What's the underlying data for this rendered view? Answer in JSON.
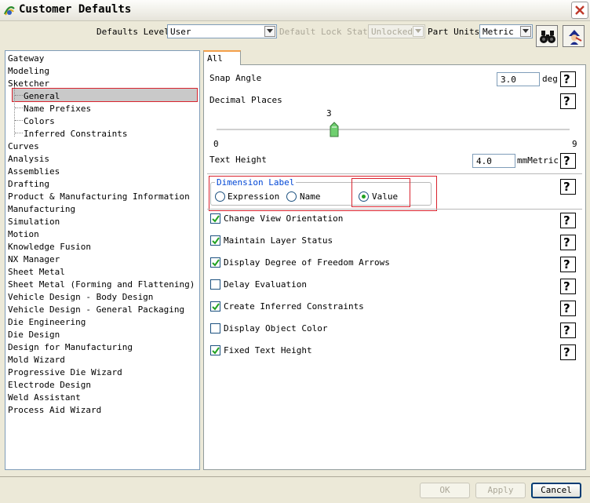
{
  "window": {
    "title": "Customer Defaults"
  },
  "toolbar": {
    "defaults_level_label": "Defaults Level",
    "defaults_level_value": "User",
    "lock_state_label": "Default Lock State",
    "lock_state_value": "Unlocked",
    "part_units_label": "Part Units",
    "part_units_value": "Metric"
  },
  "tree": {
    "items": [
      "Gateway",
      "Modeling",
      "Sketcher",
      "General",
      "Name Prefixes",
      "Colors",
      "Inferred Constraints",
      "Curves",
      "Analysis",
      "Assemblies",
      "Drafting",
      "Product & Manufacturing Information",
      "Manufacturing",
      "Simulation",
      "Motion",
      "Knowledge Fusion",
      "NX Manager",
      "Sheet Metal",
      "Sheet Metal (Forming and Flattening)",
      "Vehicle Design - Body Design",
      "Vehicle Design - General Packaging",
      "Die Engineering",
      "Die Design",
      "Design for Manufacturing",
      "Mold Wizard",
      "Progressive Die Wizard",
      "Electrode Design",
      "Weld Assistant",
      "Process Aid Wizard"
    ]
  },
  "tabs": {
    "all": "All"
  },
  "settings": {
    "snap_angle_label": "Snap Angle",
    "snap_angle_value": "3.0",
    "snap_angle_unit": "deg",
    "decimal_places_label": "Decimal Places",
    "decimal_places_value": "3",
    "slider_min": "0",
    "slider_max": "9",
    "slider_fraction": 0.3333,
    "text_height_label": "Text Height",
    "text_height_value": "4.0",
    "text_height_unit": "mmMetric",
    "dimension_label_title": "Dimension Label",
    "radio_expression": "Expression",
    "radio_name": "Name",
    "radio_value": "Value",
    "checkboxes": [
      {
        "label": "Change View Orientation",
        "checked": true
      },
      {
        "label": "Maintain Layer Status",
        "checked": true
      },
      {
        "label": "Display Degree of Freedom Arrows",
        "checked": true
      },
      {
        "label": "Delay Evaluation",
        "checked": false
      },
      {
        "label": "Create Inferred Constraints",
        "checked": true
      },
      {
        "label": "Display Object Color",
        "checked": false
      },
      {
        "label": "Fixed Text Height",
        "checked": true
      }
    ],
    "help_glyph": "?"
  },
  "buttons": {
    "ok": "OK",
    "apply": "Apply",
    "cancel": "Cancel"
  },
  "icons": [
    "nx-app-icon",
    "close-icon",
    "binoculars-icon",
    "wizard-icon",
    "help-icon",
    "chevron-down-icon",
    "checkmark-icon"
  ],
  "colors": {
    "highlight_red": "#d9232e",
    "group_title_blue": "#0046d5",
    "radio_green": "#21a121"
  }
}
